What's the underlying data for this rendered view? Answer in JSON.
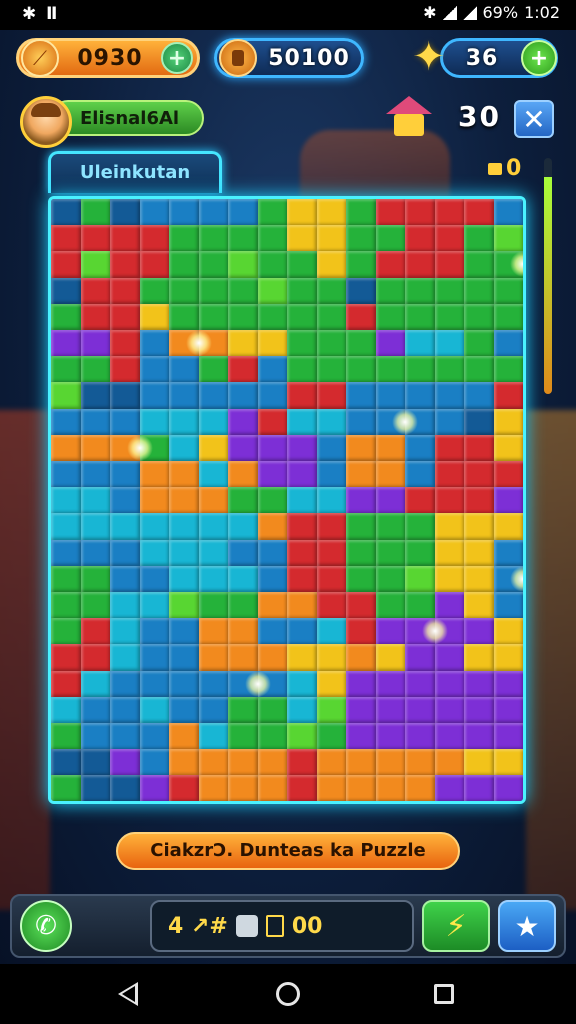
{
  "status_bar": {
    "left_icons": "✱ Ⅱ",
    "battery": "69%",
    "time": "1:02"
  },
  "hud": {
    "coins": "0930",
    "gems": "50100",
    "stars": "36",
    "level": "30"
  },
  "player": {
    "name": "Elisnal6Al"
  },
  "board": {
    "title": "Uleinkutan",
    "counter": "0",
    "progress": 0.92
  },
  "banner": {
    "text": "CiakzrƆ. Dunteas ka Puzzle"
  },
  "bottom_bar": {
    "score_prefix": "4 ↗#",
    "score_value": "00"
  },
  "icons": [
    "signal-icon",
    "wifi-icon",
    "bluetooth-icon",
    "coin-icon",
    "gem-icon",
    "star-icon",
    "hut-icon",
    "close-icon",
    "phone-icon",
    "bolt-icon",
    "star-button-icon",
    "back-icon",
    "home-icon",
    "recents-icon"
  ],
  "colors": {
    "board_border": "#4af2ff",
    "coins_pill": "#f28a1e",
    "gems_pill": "#0f2b55",
    "red": "#d42a2e",
    "green": "#25b23a",
    "blue": "#1a7fc4",
    "cyan": "#18b6d4",
    "orange": "#f28a1e",
    "yellow": "#f2c31a",
    "purple": "#7d2fd6",
    "lime": "#58d632",
    "navy": "#135a96"
  },
  "pieces": [
    "dgdbbbbgyygrrrrb",
    "rrrrggggyyggrrgl",
    "rlrrgglggygrrrgg",
    "drrgggglggdggggg",
    "grryggggggrggggg",
    "pprbooyygggpccgb",
    "ggrbbgrbgggggggg",
    "lddbbbbbrrbbbbbr",
    "bbbcccprccbbbbdy",
    "ooogcypppboobrry",
    "bbboocoppboobrrr",
    "ccboooggccpprrrp",
    "cccccccorrgggyyy",
    "bbbcccbbrrgggyyb",
    "ggbbcccbrrgglyyb",
    "ggcclggoorrggpyb",
    "grcbboobbcrppppy",
    "rrcbboooyyoyppyy",
    "rcbbbbbbcypppppp",
    "cbbcbbggclpppppp",
    "gbbbocgglgpppppp",
    "ddpbooooroooooyy",
    "gddprooorooooppp"
  ],
  "highlights": [
    [
      3,
      9
    ],
    [
      5,
      5
    ],
    [
      12,
      8
    ],
    [
      16,
      14
    ],
    [
      16,
      2
    ],
    [
      13,
      16
    ],
    [
      7,
      18
    ]
  ]
}
